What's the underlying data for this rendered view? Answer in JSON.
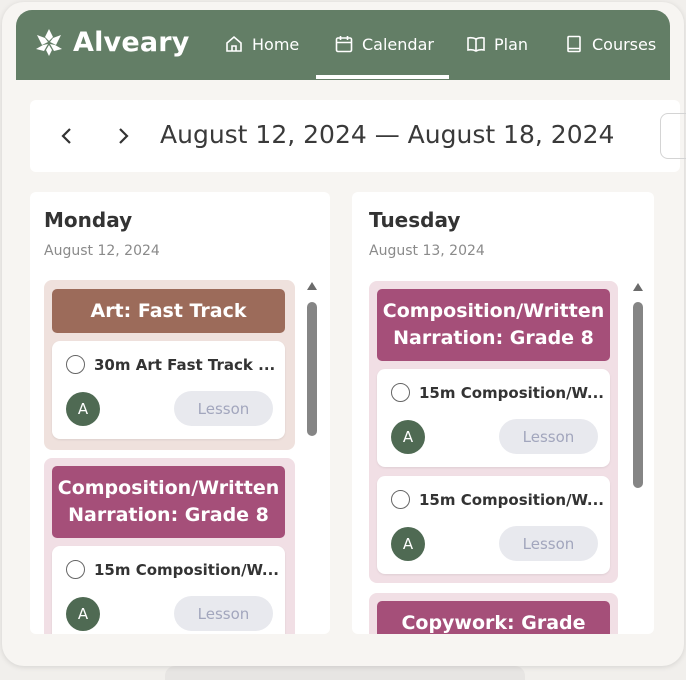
{
  "app": {
    "name": "Alveary"
  },
  "nav": [
    {
      "label": "Home",
      "icon": "home-icon"
    },
    {
      "label": "Calendar",
      "icon": "calendar-icon",
      "active": true
    },
    {
      "label": "Plan",
      "icon": "book-open-icon"
    },
    {
      "label": "Courses",
      "icon": "book-icon"
    }
  ],
  "date_range": {
    "label": "August 12, 2024 — August 18, 2024",
    "prev": "‹",
    "next": "›"
  },
  "days": [
    {
      "name": "Monday",
      "date": "August 12, 2024",
      "groups": [
        {
          "title": "Art: Fast Track",
          "color": "#9c6b5a",
          "bg": "#efe1dd",
          "tasks": [
            {
              "text": "30m Art Fast Track ...",
              "avatar": "A",
              "badge": "Lesson"
            }
          ]
        },
        {
          "title": "Composition/Written Narration: Grade 8",
          "color": "#a54f79",
          "bg": "#f1dfe5",
          "tasks": [
            {
              "text": "15m Composition/W...",
              "avatar": "A",
              "badge": "Lesson"
            }
          ]
        }
      ]
    },
    {
      "name": "Tuesday",
      "date": "August 13, 2024",
      "groups": [
        {
          "title": "Composition/Written Narration: Grade 8",
          "color": "#a54f79",
          "bg": "#f1dfe5",
          "tasks": [
            {
              "text": "15m Composition/W...",
              "avatar": "A",
              "badge": "Lesson"
            },
            {
              "text": "15m Composition/W...",
              "avatar": "A",
              "badge": "Lesson"
            }
          ]
        },
        {
          "title": "Copywork: Grade",
          "color": "#a54f79",
          "bg": "#f1dfe5",
          "tasks": []
        }
      ]
    }
  ],
  "colors": {
    "header": "#637e66",
    "avatar": "#4f6a53",
    "badge_bg": "#e8e9ee",
    "badge_text": "#a2a6bd"
  }
}
